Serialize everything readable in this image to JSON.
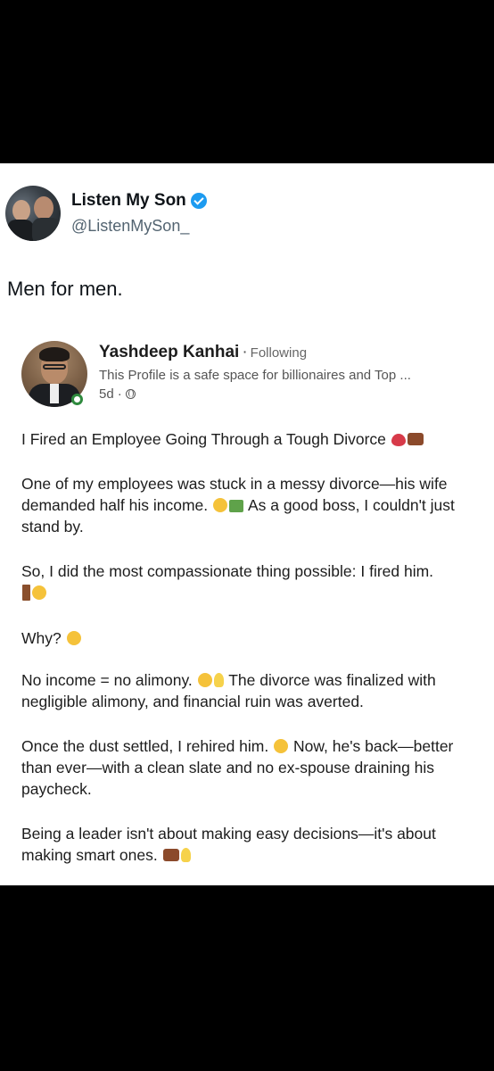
{
  "tweet": {
    "author_name": "Listen My Son",
    "handle": "@ListenMySon_",
    "text": "Men for men."
  },
  "embedded_post": {
    "author_name": "Yashdeep Kanhai",
    "separator": "·",
    "follow_status": "Following",
    "headline": "This Profile is a safe space for billionaires and Top ...",
    "age": "5d",
    "meta_dot": "·",
    "title": "I Fired an Employee Going Through a Tough Divorce",
    "p1a": "One of my employees was stuck in a messy divorce—his wife demanded half his income.",
    "p1b": "As a good boss, I couldn't just stand by.",
    "p2": "So, I did the most compassionate thing possible: I fired him.",
    "p3": "Why?",
    "p4a": "No income = no alimony.",
    "p4b": "The divorce was finalized with negligible alimony, and financial ruin was averted.",
    "p5a": "Once the dust settled, I rehired him.",
    "p5b": "Now, he's back—better than ever—with a clean slate and no ex-spouse draining his paycheck.",
    "p6": "Being a leader isn't about making easy decisions—it's about making smart ones."
  },
  "icons": {
    "verified": "verified-badge-icon",
    "globe": "globe-icon",
    "emojis": [
      "broken-heart",
      "briefcase",
      "shocked-face",
      "money-with-wings",
      "door",
      "waving-hand",
      "thinking-face",
      "money-mouth-face",
      "light-bulb",
      "slightly-frowning-face"
    ]
  },
  "colors": {
    "verified": "#1d9bf0",
    "handle": "#536471",
    "online": "#2f8a3e"
  }
}
